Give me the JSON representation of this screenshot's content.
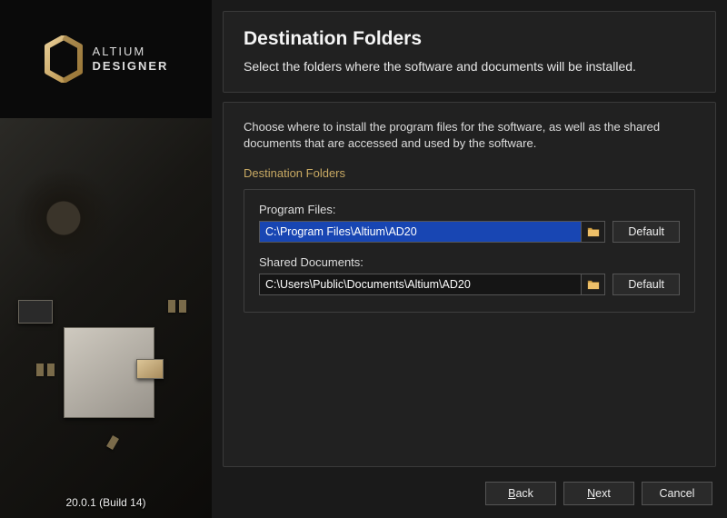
{
  "brand": {
    "line1": "ALTIUM",
    "line2": "DESIGNER"
  },
  "version": "20.0.1 (Build 14)",
  "header": {
    "title": "Destination Folders",
    "subtitle": "Select the folders where the software and documents will be installed."
  },
  "body": {
    "intro": "Choose where to install the program files for the software, as well as the shared documents that are accessed and used by the software.",
    "section_title": "Destination Folders",
    "fields": {
      "program": {
        "label": "Program Files:",
        "value": "C:\\Program Files\\Altium\\AD20",
        "default_label": "Default"
      },
      "shared": {
        "label": "Shared Documents:",
        "value": "C:\\Users\\Public\\Documents\\Altium\\AD20",
        "default_label": "Default"
      }
    }
  },
  "footer": {
    "back": "Back",
    "next": "Next",
    "cancel": "Cancel"
  }
}
